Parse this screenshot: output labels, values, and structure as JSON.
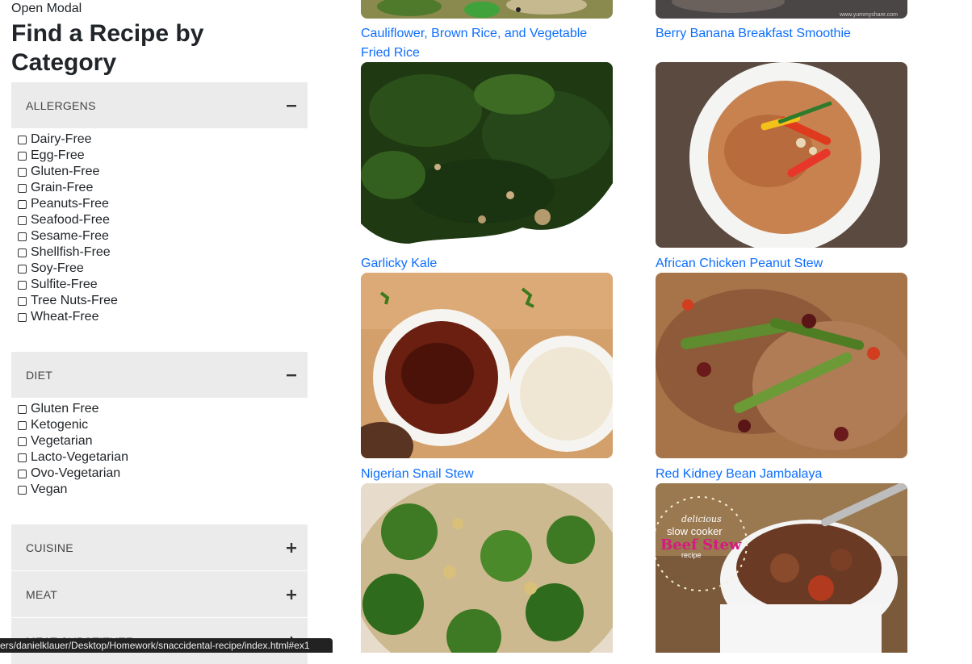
{
  "sidebar": {
    "open_modal": "Open Modal",
    "title": "Find a Recipe by Category",
    "sections": [
      {
        "title": "ALLERGENS",
        "toggle": "minus-icon",
        "items": [
          "Dairy-Free",
          "Egg-Free",
          "Gluten-Free",
          "Grain-Free",
          "Peanuts-Free",
          "Seafood-Free",
          "Sesame-Free",
          "Shellfish-Free",
          "Soy-Free",
          "Sulfite-Free",
          "Tree Nuts-Free",
          "Wheat-Free"
        ]
      },
      {
        "title": "DIET",
        "toggle": "minus-icon",
        "items": [
          "Gluten Free",
          "Ketogenic",
          "Vegetarian",
          "Lacto-Vegetarian",
          "Ovo-Vegetarian",
          "Vegan"
        ]
      },
      {
        "title": "CUISINE",
        "toggle": "plus-icon"
      },
      {
        "title": "MEAT",
        "toggle": "plus-icon"
      },
      {
        "title": "MEAT SUBSTITUTE",
        "toggle": "plus-icon"
      }
    ]
  },
  "recipes": [
    {
      "title": "Cauliflower, Brown Rice, and Vegetable Fried Rice"
    },
    {
      "title": "Berry Banana Breakfast Smoothie",
      "watermark": "www.yummyshare.com"
    },
    {
      "title": "Garlicky Kale"
    },
    {
      "title": "African Chicken Peanut Stew"
    },
    {
      "title": "Nigerian Snail Stew"
    },
    {
      "title": "Red Kidney Bean Jambalaya"
    },
    {
      "title": ""
    },
    {
      "title": "",
      "overlay": [
        "delicious",
        "slow cooker",
        "Beef Stew",
        "recipe"
      ]
    }
  ],
  "status_bar": {
    "url": "ers/danielklauer/Desktop/Homework/snaccidental-recipe/index.html#ex1"
  },
  "colors": {
    "link": "#0d6efd",
    "accordion_bg": "#ebebeb",
    "status_bg": "#222222"
  }
}
